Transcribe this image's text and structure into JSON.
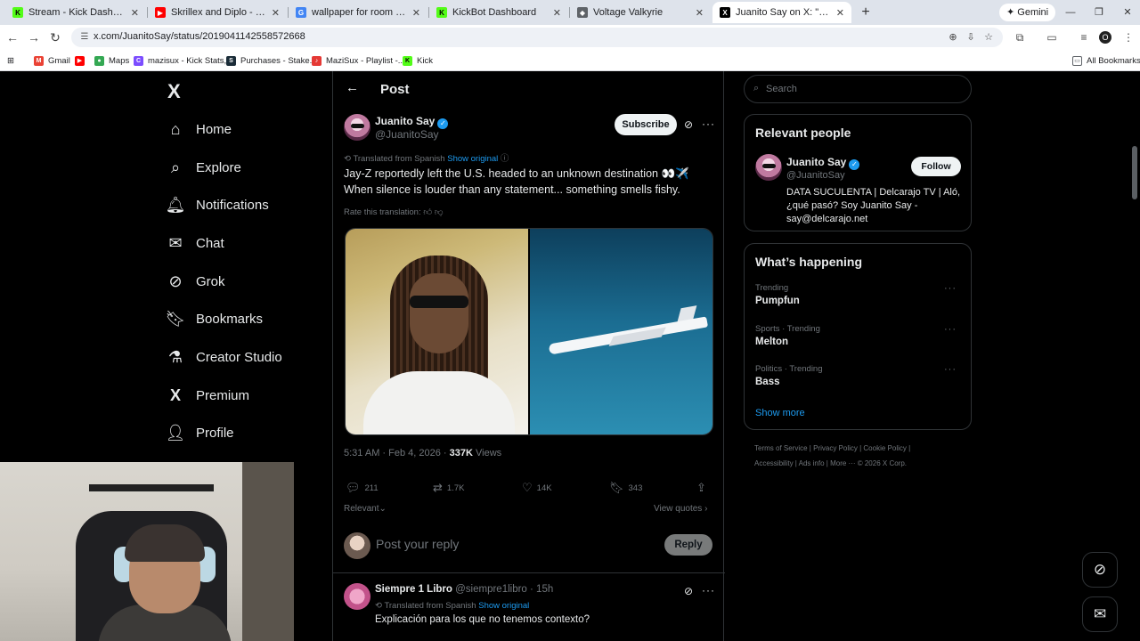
{
  "browser": {
    "tabs": [
      {
        "title": "Stream - Kick Dashboard",
        "fav": "K",
        "color": "#53fc18"
      },
      {
        "title": "Skrillex and Diplo - \"Where Are",
        "fav": "▶",
        "color": "#ff0000"
      },
      {
        "title": "wallpaper for room walls - Goo",
        "fav": "G",
        "color": "#4285f4"
      },
      {
        "title": "KickBot Dashboard",
        "fav": "K",
        "color": "#53fc18"
      },
      {
        "title": "Voltage Valkyrie",
        "fav": "◆",
        "color": "#5f6368"
      },
      {
        "title": "Juanito Say on X: \"Jay-Z habría",
        "fav": "X",
        "color": "#000000"
      }
    ],
    "gemini_label": "Gemini",
    "url": "x.com/JuanitoSay/status/2019041142558572668",
    "bookmarks": [
      {
        "label": "Gmail",
        "fav": "M",
        "color": "#ea4335"
      },
      {
        "label": "",
        "fav": "▶",
        "color": "#ff0000"
      },
      {
        "label": "Maps",
        "fav": "●",
        "color": "#34a853"
      },
      {
        "label": "mazisux - Kick Stats,...",
        "fav": "C",
        "color": "#7c4dff"
      },
      {
        "label": "Purchases - Stake.us",
        "fav": "S",
        "color": "#1a2c38"
      },
      {
        "label": "MaziSux - Playlist -...",
        "fav": "♪",
        "color": "#e53935"
      },
      {
        "label": "Kick",
        "fav": "K",
        "color": "#53fc18"
      }
    ],
    "all_bookmarks": "All Bookmarks"
  },
  "nav": {
    "logo": "X",
    "items": [
      {
        "label": "Home",
        "icon": "⌂",
        "name": "home-icon"
      },
      {
        "label": "Explore",
        "icon": "⌕",
        "name": "search-icon"
      },
      {
        "label": "Notifications",
        "icon": "🔔︎",
        "name": "bell-icon"
      },
      {
        "label": "Chat",
        "icon": "✉",
        "name": "mail-icon"
      },
      {
        "label": "Grok",
        "icon": "⊘",
        "name": "grok-icon"
      },
      {
        "label": "Bookmarks",
        "icon": "🔖︎",
        "name": "bookmark-icon"
      },
      {
        "label": "Creator Studio",
        "icon": "⚗",
        "name": "flask-icon"
      },
      {
        "label": "Premium",
        "icon": "X",
        "name": "x-premium-icon"
      },
      {
        "label": "Profile",
        "icon": "👤︎",
        "name": "profile-icon"
      }
    ]
  },
  "post": {
    "header_title": "Post",
    "author_name": "Juanito Say",
    "author_handle": "@JuanitoSay",
    "subscribe_label": "Subscribe",
    "translated_label": "Translated from Spanish",
    "show_original": "Show original",
    "text_line1": "Jay-Z reportedly left the U.S. headed to an unknown destination 👀✈️",
    "text_line2": "When silence is louder than any statement... something smells fishy.",
    "rate_label": "Rate this translation:",
    "time": "5:31 AM · Feb 4, 2026 ·",
    "views_count": "337K",
    "views_label": "Views",
    "replies": "211",
    "reposts": "1.7K",
    "likes": "14K",
    "bookmarks": "343",
    "relevant_label": "Relevant",
    "view_quotes": "View quotes",
    "reply_placeholder": "Post your reply",
    "reply_button": "Reply"
  },
  "reply_item": {
    "name": "Siempre 1 Libro",
    "handle": "@siempre1libro · 15h",
    "translated_label": "Translated from Spanish",
    "show_original": "Show original",
    "text": "Explicación para los que no tenemos contexto?"
  },
  "sidebar": {
    "search_placeholder": "Search",
    "relevant_title": "Relevant people",
    "person_name": "Juanito Say",
    "person_handle": "@JuanitoSay",
    "follow_label": "Follow",
    "bio": "DATA SUCULENTA | Delcarajo TV | Aló, ¿qué pasó? Soy Juanito Say - say@delcarajo.net",
    "happening_title": "What’s happening",
    "trends": [
      {
        "category": "Trending",
        "name": "Pumpfun"
      },
      {
        "category": "Sports · Trending",
        "name": "Melton"
      },
      {
        "category": "Politics · Trending",
        "name": "Bass"
      }
    ],
    "show_more": "Show more",
    "footer_line1": "Terms of Service  |  Privacy Policy  |  Cookie Policy  |",
    "footer_line2": "Accessibility  |  Ads info  |  More ···  © 2026 X Corp."
  }
}
